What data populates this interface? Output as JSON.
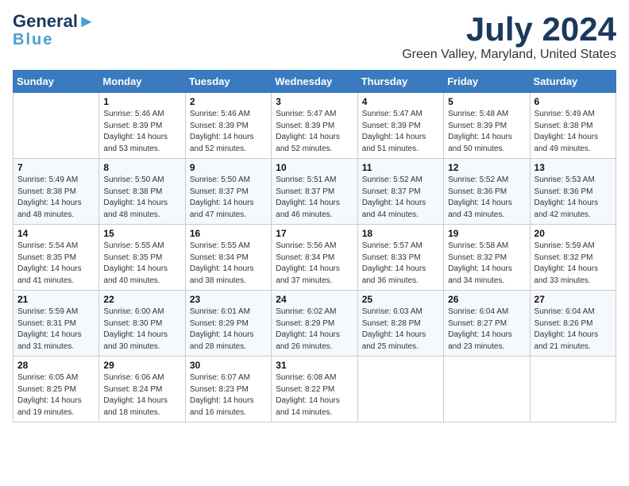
{
  "header": {
    "logo_general": "General",
    "logo_blue": "Blue",
    "month_title": "July 2024",
    "location": "Green Valley, Maryland, United States"
  },
  "weekdays": [
    "Sunday",
    "Monday",
    "Tuesday",
    "Wednesday",
    "Thursday",
    "Friday",
    "Saturday"
  ],
  "weeks": [
    [
      {
        "day": null
      },
      {
        "day": 1,
        "sunrise": "5:46 AM",
        "sunset": "8:39 PM",
        "daylight": "14 hours and 53 minutes."
      },
      {
        "day": 2,
        "sunrise": "5:46 AM",
        "sunset": "8:39 PM",
        "daylight": "14 hours and 52 minutes."
      },
      {
        "day": 3,
        "sunrise": "5:47 AM",
        "sunset": "8:39 PM",
        "daylight": "14 hours and 52 minutes."
      },
      {
        "day": 4,
        "sunrise": "5:47 AM",
        "sunset": "8:39 PM",
        "daylight": "14 hours and 51 minutes."
      },
      {
        "day": 5,
        "sunrise": "5:48 AM",
        "sunset": "8:39 PM",
        "daylight": "14 hours and 50 minutes."
      },
      {
        "day": 6,
        "sunrise": "5:49 AM",
        "sunset": "8:38 PM",
        "daylight": "14 hours and 49 minutes."
      }
    ],
    [
      {
        "day": 7,
        "sunrise": "5:49 AM",
        "sunset": "8:38 PM",
        "daylight": "14 hours and 48 minutes."
      },
      {
        "day": 8,
        "sunrise": "5:50 AM",
        "sunset": "8:38 PM",
        "daylight": "14 hours and 48 minutes."
      },
      {
        "day": 9,
        "sunrise": "5:50 AM",
        "sunset": "8:37 PM",
        "daylight": "14 hours and 47 minutes."
      },
      {
        "day": 10,
        "sunrise": "5:51 AM",
        "sunset": "8:37 PM",
        "daylight": "14 hours and 46 minutes."
      },
      {
        "day": 11,
        "sunrise": "5:52 AM",
        "sunset": "8:37 PM",
        "daylight": "14 hours and 44 minutes."
      },
      {
        "day": 12,
        "sunrise": "5:52 AM",
        "sunset": "8:36 PM",
        "daylight": "14 hours and 43 minutes."
      },
      {
        "day": 13,
        "sunrise": "5:53 AM",
        "sunset": "8:36 PM",
        "daylight": "14 hours and 42 minutes."
      }
    ],
    [
      {
        "day": 14,
        "sunrise": "5:54 AM",
        "sunset": "8:35 PM",
        "daylight": "14 hours and 41 minutes."
      },
      {
        "day": 15,
        "sunrise": "5:55 AM",
        "sunset": "8:35 PM",
        "daylight": "14 hours and 40 minutes."
      },
      {
        "day": 16,
        "sunrise": "5:55 AM",
        "sunset": "8:34 PM",
        "daylight": "14 hours and 38 minutes."
      },
      {
        "day": 17,
        "sunrise": "5:56 AM",
        "sunset": "8:34 PM",
        "daylight": "14 hours and 37 minutes."
      },
      {
        "day": 18,
        "sunrise": "5:57 AM",
        "sunset": "8:33 PM",
        "daylight": "14 hours and 36 minutes."
      },
      {
        "day": 19,
        "sunrise": "5:58 AM",
        "sunset": "8:32 PM",
        "daylight": "14 hours and 34 minutes."
      },
      {
        "day": 20,
        "sunrise": "5:59 AM",
        "sunset": "8:32 PM",
        "daylight": "14 hours and 33 minutes."
      }
    ],
    [
      {
        "day": 21,
        "sunrise": "5:59 AM",
        "sunset": "8:31 PM",
        "daylight": "14 hours and 31 minutes."
      },
      {
        "day": 22,
        "sunrise": "6:00 AM",
        "sunset": "8:30 PM",
        "daylight": "14 hours and 30 minutes."
      },
      {
        "day": 23,
        "sunrise": "6:01 AM",
        "sunset": "8:29 PM",
        "daylight": "14 hours and 28 minutes."
      },
      {
        "day": 24,
        "sunrise": "6:02 AM",
        "sunset": "8:29 PM",
        "daylight": "14 hours and 26 minutes."
      },
      {
        "day": 25,
        "sunrise": "6:03 AM",
        "sunset": "8:28 PM",
        "daylight": "14 hours and 25 minutes."
      },
      {
        "day": 26,
        "sunrise": "6:04 AM",
        "sunset": "8:27 PM",
        "daylight": "14 hours and 23 minutes."
      },
      {
        "day": 27,
        "sunrise": "6:04 AM",
        "sunset": "8:26 PM",
        "daylight": "14 hours and 21 minutes."
      }
    ],
    [
      {
        "day": 28,
        "sunrise": "6:05 AM",
        "sunset": "8:25 PM",
        "daylight": "14 hours and 19 minutes."
      },
      {
        "day": 29,
        "sunrise": "6:06 AM",
        "sunset": "8:24 PM",
        "daylight": "14 hours and 18 minutes."
      },
      {
        "day": 30,
        "sunrise": "6:07 AM",
        "sunset": "8:23 PM",
        "daylight": "14 hours and 16 minutes."
      },
      {
        "day": 31,
        "sunrise": "6:08 AM",
        "sunset": "8:22 PM",
        "daylight": "14 hours and 14 minutes."
      },
      {
        "day": null
      },
      {
        "day": null
      },
      {
        "day": null
      }
    ]
  ]
}
